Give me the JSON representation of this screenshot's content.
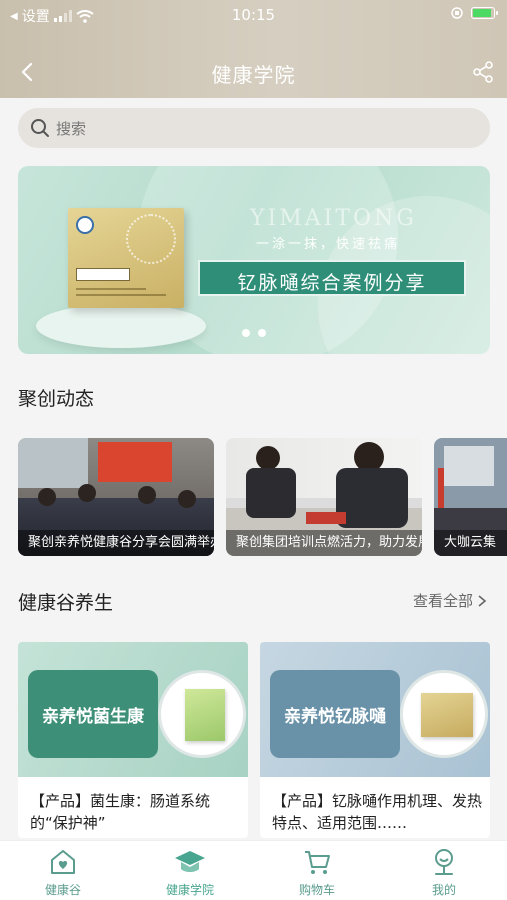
{
  "status_bar": {
    "back_app_label": "设置",
    "time": "10:15"
  },
  "nav": {
    "title": "健康学院"
  },
  "search": {
    "placeholder": "搜索"
  },
  "banner": {
    "watermark": "YIMAITONG",
    "subtitle": "一涂一抹，快速祛痛",
    "title": "钇脉嗵综合案例分享",
    "page_count": 2
  },
  "sections": {
    "news_title": "聚创动态",
    "health_title": "健康谷养生",
    "see_all": "查看全部"
  },
  "news": [
    {
      "caption": "聚创亲养悦健康谷分享会圆满举办"
    },
    {
      "caption": "聚创集团培训点燃活力，助力发展"
    },
    {
      "caption": "大咖云集"
    }
  ],
  "products": [
    {
      "label": "亲养悦菌生康",
      "text": "【产品】菌生康：肠道系统的“保护神”"
    },
    {
      "label": "亲养悦钇脉嗵",
      "text": "【产品】钇脉嗵作用机理、发热特点、适用范围……"
    }
  ],
  "tabs": [
    {
      "label": "健康谷",
      "active": false
    },
    {
      "label": "健康学院",
      "active": true
    },
    {
      "label": "购物车",
      "active": false
    },
    {
      "label": "我的",
      "active": false
    }
  ],
  "colors": {
    "accent": "#48a58f",
    "tab_inactive": "#5a9c8e",
    "header": "#cec5b4"
  }
}
